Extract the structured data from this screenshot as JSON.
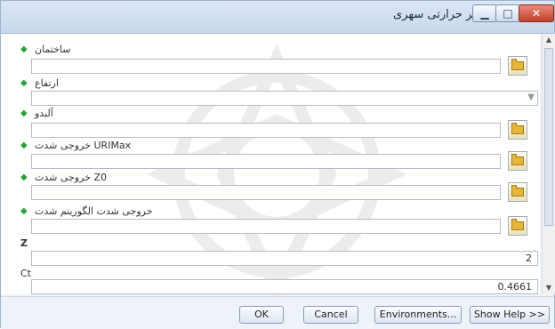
{
  "window": {
    "title": "سمت چزایر حرارتی سهری",
    "minimize_glyph": "▁",
    "maximize_glyph": "□",
    "close_glyph": "✕"
  },
  "fields": [
    {
      "label": "ساختمان",
      "value": ""
    },
    {
      "label": "ارتفاع",
      "value": ""
    },
    {
      "label": "آلبدو",
      "value": ""
    },
    {
      "label": "URIMax خروجی شدت",
      "value": ""
    },
    {
      "label": "Z0 خروجی شدت",
      "value": ""
    },
    {
      "label": "خروجی شدت الگوریتم شدت",
      "value": ""
    },
    {
      "label": "Z",
      "value": "2"
    },
    {
      "label": "Ct",
      "value": "0.4661"
    }
  ],
  "buttons": {
    "ok": "OK",
    "cancel": "Cancel",
    "environments": "Environments...",
    "show_help": "Show Help >>"
  },
  "icons": {
    "title_icon": "hammer-icon",
    "browse_icon": "folder-icon",
    "required_icon": "green-diamond-icon",
    "combo_icon": "chevron-down-icon"
  },
  "colors": {
    "title_bar": "#c7d8ec",
    "close_button": "#c3402a",
    "required_marker": "#2aa23a",
    "window_bg": "#eef3fa"
  }
}
